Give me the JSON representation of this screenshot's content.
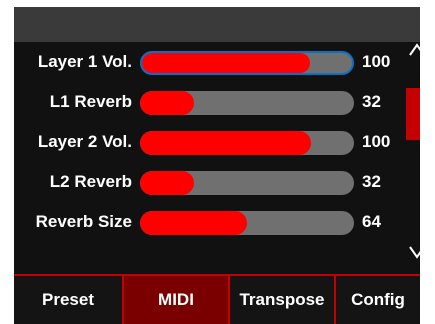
{
  "params": [
    {
      "label": "Layer 1 Vol.",
      "value": "100",
      "level": 0.8,
      "selected": true
    },
    {
      "label": "L1 Reverb",
      "value": "32",
      "level": 0.25,
      "selected": false
    },
    {
      "label": "Layer 2 Vol.",
      "value": "100",
      "level": 0.8,
      "selected": false
    },
    {
      "label": "L2 Reverb",
      "value": "32",
      "level": 0.25,
      "selected": false
    },
    {
      "label": "Reverb Size",
      "value": "64",
      "level": 0.5,
      "selected": false
    }
  ],
  "scroll": {
    "up_icon": "chevron-up-icon",
    "down_icon": "chevron-down-icon",
    "position": 0.2,
    "visible_fraction": 0.3
  },
  "tabs": [
    {
      "label": "Preset",
      "active": false
    },
    {
      "label": "MIDI",
      "active": true
    },
    {
      "label": "Transpose",
      "active": false
    },
    {
      "label": "Config",
      "active": false
    }
  ],
  "colors": {
    "fill": "#ff0000",
    "track": "#707070",
    "accent": "#c40000",
    "active_tab": "#7a0000",
    "selection": "#0a6fc9"
  }
}
